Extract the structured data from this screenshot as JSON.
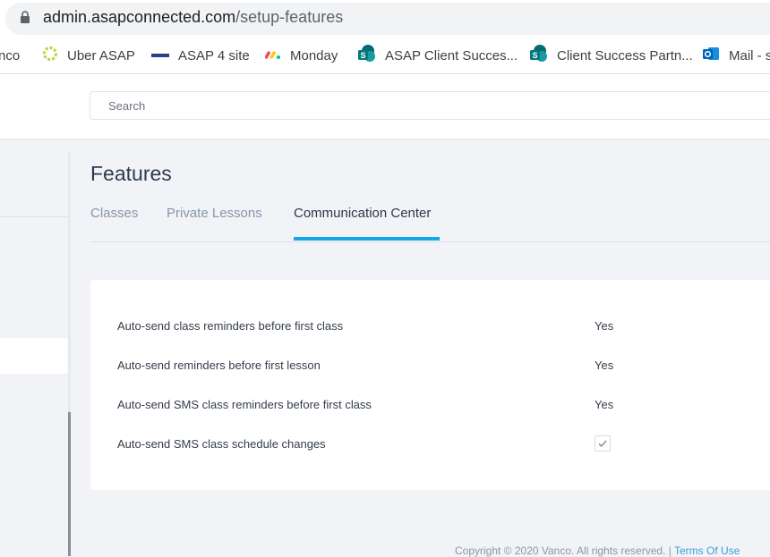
{
  "browser": {
    "url_host": "admin.asapconnected.com",
    "url_path": "/setup-features",
    "bookmarks": [
      {
        "label": "nco",
        "icon": "none"
      },
      {
        "label": "Uber ASAP",
        "icon": "uber-asap-icon"
      },
      {
        "label": "ASAP 4 site",
        "icon": "asap-logo-icon"
      },
      {
        "label": "Monday",
        "icon": "monday-icon"
      },
      {
        "label": "ASAP Client Succes...",
        "icon": "sharepoint-icon"
      },
      {
        "label": "Client Success Partn...",
        "icon": "sharepoint-icon"
      },
      {
        "label": "Mail - s",
        "icon": "outlook-icon"
      }
    ]
  },
  "header": {
    "search_placeholder": "Search"
  },
  "main": {
    "title": "Features",
    "tabs": [
      {
        "label": "Classes",
        "active": false
      },
      {
        "label": "Private Lessons",
        "active": false
      },
      {
        "label": "Communication Center",
        "active": true
      }
    ],
    "settings": [
      {
        "label": "Auto-send class reminders before first class",
        "value": "Yes"
      },
      {
        "label": "Auto-send reminders before first lesson",
        "value": "Yes"
      },
      {
        "label": "Auto-send SMS class reminders before first class",
        "value": "Yes"
      },
      {
        "label": "Auto-send SMS class schedule changes",
        "value": "checked"
      }
    ]
  },
  "footer": {
    "copyright": "Copyright © 2020 Vanco. All rights reserved. |",
    "terms_link": "Terms Of Use"
  },
  "colors": {
    "accent": "#10a8e5",
    "background": "#f1f3f7",
    "link": "#3aa0d8"
  }
}
